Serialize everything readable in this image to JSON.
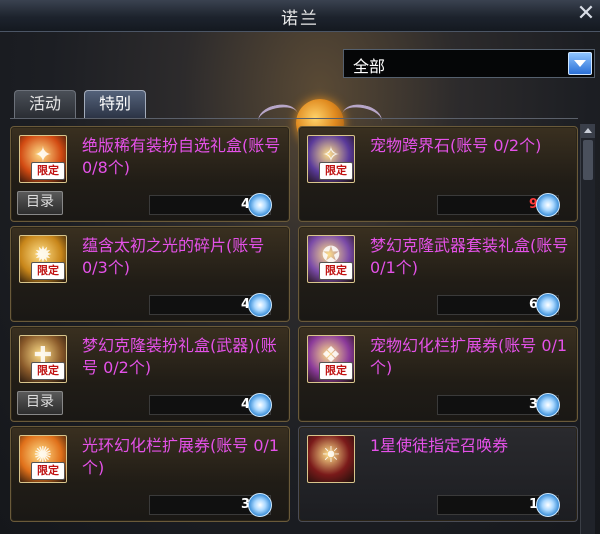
{
  "window": {
    "title": "诺兰"
  },
  "filter": {
    "selected": "全部"
  },
  "tabs": [
    {
      "label": "活动",
      "active": false
    },
    {
      "label": "特别",
      "active": true
    }
  ],
  "items": [
    {
      "name": "绝版稀有装扮自选礼盒(账号 0/8个)",
      "badge": "限定",
      "has_catalog": true,
      "catalog_label": "目录",
      "quantity": "4",
      "quantity_color": "white",
      "icon": "gift-box-icon"
    },
    {
      "name": "宠物跨界石(账号 0/2个)",
      "badge": "限定",
      "has_catalog": false,
      "quantity": "9",
      "quantity_color": "red",
      "icon": "crystal-icon"
    },
    {
      "name": "蕴含太初之光的碎片(账号 0/3个)",
      "badge": "限定",
      "has_catalog": false,
      "quantity": "4",
      "quantity_color": "white",
      "icon": "light-shard-icon"
    },
    {
      "name": "梦幻克隆武器套装礼盒(账号 0/1个)",
      "badge": "限定",
      "has_catalog": false,
      "quantity": "6",
      "quantity_color": "white",
      "icon": "weapon-box-icon"
    },
    {
      "name": "梦幻克隆装扮礼盒(武器)(账号 0/2个)",
      "badge": "限定",
      "has_catalog": true,
      "catalog_label": "目录",
      "quantity": "4",
      "quantity_color": "white",
      "icon": "clone-box-icon"
    },
    {
      "name": "宠物幻化栏扩展券(账号 0/1个)",
      "badge": "限定",
      "has_catalog": false,
      "quantity": "3",
      "quantity_color": "white",
      "icon": "pet-ticket-icon"
    },
    {
      "name": "光环幻化栏扩展券(账号 0/1个)",
      "badge": "限定",
      "has_catalog": false,
      "quantity": "3",
      "quantity_color": "white",
      "icon": "aura-ticket-icon"
    },
    {
      "name": "1星使徒指定召唤券",
      "badge": "",
      "has_catalog": false,
      "quantity": "1",
      "quantity_color": "white",
      "icon": "apostle-summon-icon"
    }
  ],
  "item_icon_colors": [
    "#d24a12",
    "#5a3a9a",
    "#c8861a",
    "#7a4aa8",
    "#8a5a2a",
    "#8b3a9a",
    "#e0701a",
    "#7a1a1a"
  ]
}
